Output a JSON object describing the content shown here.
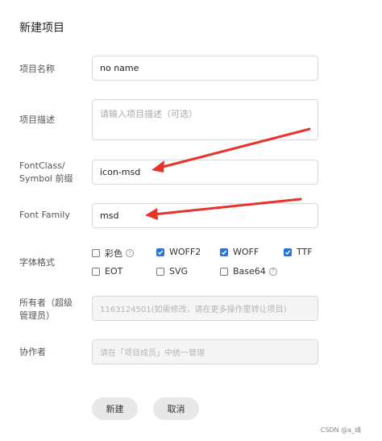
{
  "dialog": {
    "title": "新建项目"
  },
  "fields": {
    "name": {
      "label": "项目名称",
      "value": "no name"
    },
    "desc": {
      "label": "项目描述",
      "placeholder": "请输入项目描述（可选）"
    },
    "fontclass": {
      "label_line1": "FontClass/",
      "label_line2": "Symbol 前缀",
      "value": "icon-msd"
    },
    "fontfamily": {
      "label": "Font Family",
      "value": "msd"
    },
    "format": {
      "label": "字体格式",
      "options": [
        {
          "label": "彩色",
          "checked": false,
          "help": true
        },
        {
          "label": "WOFF2",
          "checked": true
        },
        {
          "label": "WOFF",
          "checked": true
        },
        {
          "label": "TTF",
          "checked": true
        },
        {
          "label": "EOT",
          "checked": false
        },
        {
          "label": "SVG",
          "checked": false
        },
        {
          "label": "Base64",
          "checked": false,
          "help": true
        }
      ]
    },
    "owner": {
      "label_line1": "所有者（超级",
      "label_line2": "管理员）",
      "value": "1163124501(如需修改，请在更多操作里转让项目)"
    },
    "collab": {
      "label": "协作者",
      "placeholder": "请在「项目成员」中统一管理"
    }
  },
  "buttons": {
    "create": "新建",
    "cancel": "取消"
  },
  "help_glyph": "?",
  "watermark": "CSDN @a_靖",
  "colors": {
    "accent": "#2b74d6",
    "arrow": "#e8332a"
  }
}
